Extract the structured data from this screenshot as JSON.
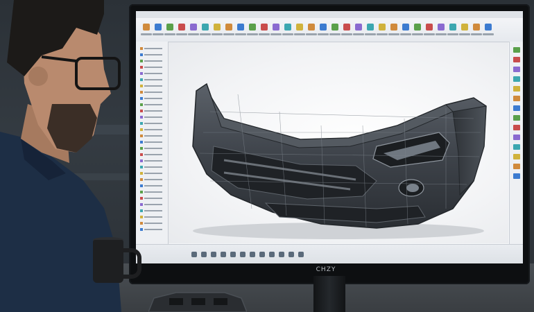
{
  "scene": {
    "description_free": true,
    "monitor_brand": "CHZY"
  },
  "colors": {
    "shirt": "#1d2e45",
    "skin": "#b98a6e",
    "hair": "#1c1a18",
    "bumper": "#3d4249",
    "screen_bg": "#f4f6f8",
    "accent_orange": "#d08a3c",
    "accent_blue": "#3c7bd0"
  },
  "icons": {
    "ribbon": "toolbar-tool-icons",
    "tree": "model-tree-icons",
    "right": "display-toolbar-icons",
    "taskbar": "taskbar-app-icons"
  }
}
